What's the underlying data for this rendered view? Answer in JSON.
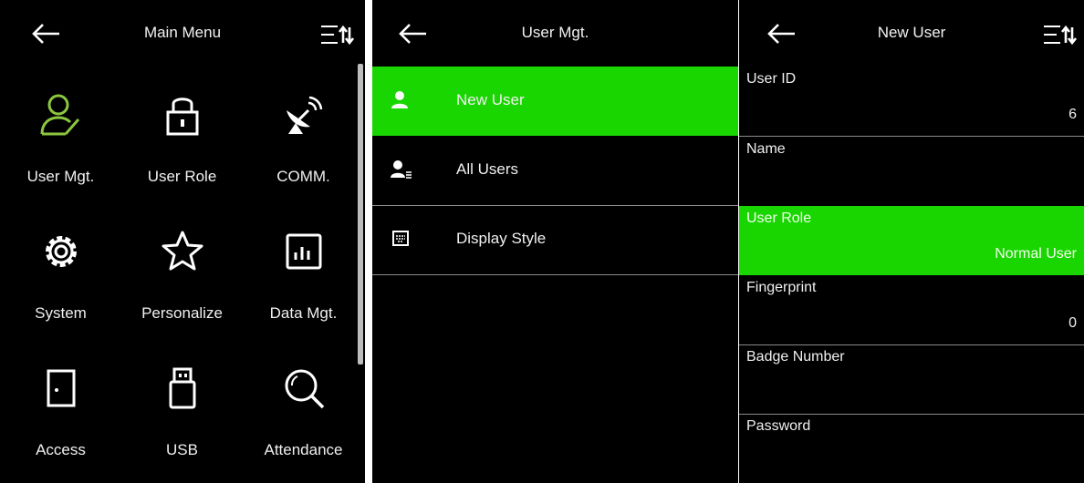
{
  "main_menu": {
    "title": "Main Menu",
    "items": [
      {
        "label": "User Mgt.",
        "icon": "user-icon"
      },
      {
        "label": "User Role",
        "icon": "lock-icon"
      },
      {
        "label": "COMM.",
        "icon": "satellite-dish-icon"
      },
      {
        "label": "System",
        "icon": "gear-icon"
      },
      {
        "label": "Personalize",
        "icon": "star-icon"
      },
      {
        "label": "Data Mgt.",
        "icon": "bar-chart-icon"
      },
      {
        "label": "Access",
        "icon": "door-icon"
      },
      {
        "label": "USB",
        "icon": "usb-icon"
      },
      {
        "label": "Attendance",
        "icon": "search-icon"
      }
    ]
  },
  "user_mgt": {
    "title": "User Mgt.",
    "items": [
      {
        "label": "New User",
        "icon": "user-icon",
        "selected": true
      },
      {
        "label": "All Users",
        "icon": "user-list-icon",
        "selected": false
      },
      {
        "label": "Display Style",
        "icon": "display-icon",
        "selected": false
      }
    ]
  },
  "new_user": {
    "title": "New User",
    "fields": [
      {
        "label": "User ID",
        "value": "6",
        "selected": false
      },
      {
        "label": "Name",
        "value": "",
        "selected": false
      },
      {
        "label": "User Role",
        "value": "Normal User",
        "selected": true
      },
      {
        "label": "Fingerprint",
        "value": "0",
        "selected": false
      },
      {
        "label": "Badge Number",
        "value": "",
        "selected": false
      },
      {
        "label": "Password",
        "value": "",
        "selected": false
      }
    ]
  },
  "colors": {
    "highlight": "#19d600",
    "accent_icon": "#8cc63f",
    "background": "#000000"
  }
}
